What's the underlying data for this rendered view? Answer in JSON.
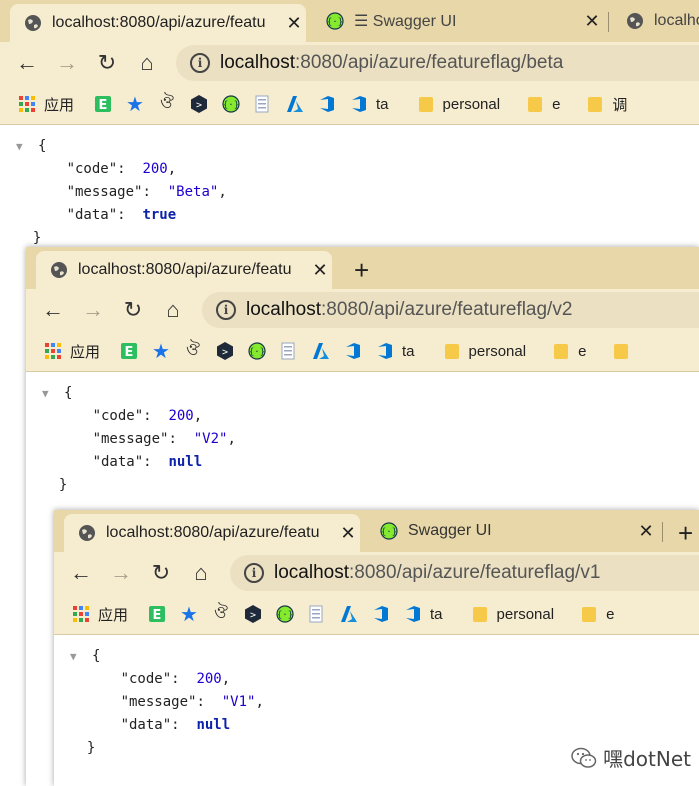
{
  "watermark": "嘿dotNet",
  "windows": [
    {
      "tabs": [
        {
          "title": "localhost:8080/api/azure/featu",
          "close": "✕"
        },
        {
          "title": "☰ Swagger UI",
          "close": "✕"
        },
        {
          "title": "localho"
        }
      ],
      "url_host": "localhost",
      "url_path": ":8080/api/azure/featureflag/beta",
      "bookmarks": {
        "apps": "应用",
        "ta": "ta",
        "personal": "personal",
        "e": "e",
        "cut": "调"
      },
      "json": {
        "code": "200",
        "message": "\"Beta\"",
        "data": "true"
      }
    },
    {
      "tabs": [
        {
          "title": "localhost:8080/api/azure/featu",
          "close": "✕"
        }
      ],
      "new_tab": "+",
      "url_host": "localhost",
      "url_path": ":8080/api/azure/featureflag/v2",
      "bookmarks": {
        "apps": "应用",
        "ta": "ta",
        "personal": "personal",
        "e": "e"
      },
      "json": {
        "code": "200",
        "message": "\"V2\"",
        "data": "null"
      }
    },
    {
      "tabs": [
        {
          "title": "localhost:8080/api/azure/featu",
          "close": "✕"
        },
        {
          "title": "Swagger UI",
          "close": "✕"
        }
      ],
      "new_tab": "+",
      "url_host": "localhost",
      "url_path": ":8080/api/azure/featureflag/v1",
      "bookmarks": {
        "apps": "应用",
        "ta": "ta",
        "personal": "personal",
        "e": "e"
      },
      "json": {
        "code": "200",
        "message": "\"V1\"",
        "data": "null"
      }
    }
  ],
  "json_keys": {
    "code": "\"code\"",
    "message": "\"message\"",
    "data": "\"data\""
  },
  "colors": {
    "tabstrip": "#e8d7a8",
    "toolbar": "#f6ecd0",
    "swagger": "#85ea2d",
    "azure": "#0078d4"
  }
}
